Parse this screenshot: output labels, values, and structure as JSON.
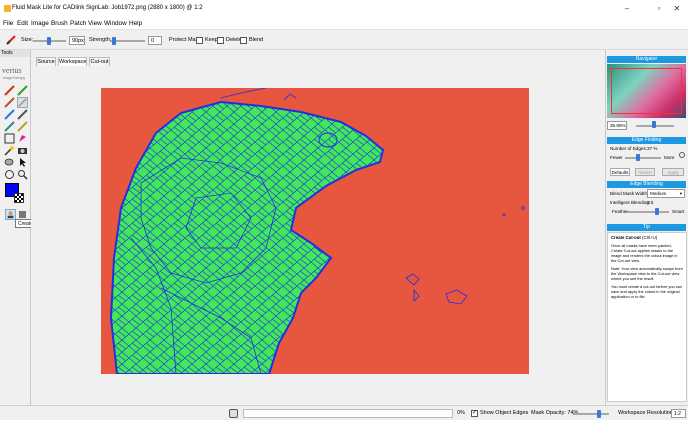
{
  "window": {
    "title": "Fluid Mask Lite for CADlink SignLab: Job1972.png (2880 x 1800) @ 1:2",
    "controls": [
      "minimize",
      "maximize",
      "close"
    ]
  },
  "menu": [
    "File",
    "Edit",
    "Image",
    "Brush",
    "Patch",
    "View",
    "Window",
    "Help"
  ],
  "toolbar": {
    "size_label": "Size:",
    "size_value": "90px",
    "strength_label": "Strength:",
    "strength_value": "0",
    "protect_label": "Protect Mask:",
    "keep_label": "Keep",
    "delete_label": "Delete",
    "blend_label": "Blend"
  },
  "left_panel": {
    "title": "Tools",
    "logo_text": "vertus",
    "logo_subtext": "image therapy",
    "tooltip": "Create Cut-out (Ctrl+U)"
  },
  "tabs": [
    "Source",
    "Workspace",
    "Cut-out"
  ],
  "active_tab": "Workspace",
  "navigator": {
    "title": "Navigator",
    "zoom": "35.86%"
  },
  "edge_finding": {
    "title": "Edge Finding",
    "edges_label": "Number of Edges:",
    "edges_value": "37 %",
    "fewer": "Fewer",
    "more": "More",
    "buttons": [
      "Defaults",
      "Revert",
      "Apply"
    ]
  },
  "edge_blending": {
    "title": "Edge Blending",
    "blend_width_label": "Blend Mask Width:",
    "blend_width_value": "Medium",
    "intelligent_label": "Intelligent Blending:",
    "intelligent_value": "0.5",
    "feather_label": "Feather",
    "smart_label": "Smart"
  },
  "tip": {
    "title": "Tip",
    "heading": "Create Cut-out",
    "shortcut": "(Ctrl+U)",
    "p1": "Once all masks have been painted, Create Cut-out applies masks to the image and renders the cutout image in the Cut-out view.",
    "p2": "Note: Your view automatically swaps from the Workspace view to the Cut-out view where you see the result.",
    "p3": "You must create a cut-out before you can save and apply the cutout in the original application or to file."
  },
  "status": {
    "progress": "0%",
    "show_edges_label": "Show Object Edges",
    "show_edges_checked": true,
    "mask_opacity": "Mask Opacity: 74%",
    "mask_opacity_level": 0.74,
    "workspace_resolution_label": "Workspace Resolution:",
    "workspace_resolution_value": "1:2"
  },
  "colors": {
    "image_bg": "#e7563f",
    "mask_green": "#43e85a",
    "edges_blue": "#2030e0",
    "panel_header": "#1d99e3",
    "foreground_swatch": "#0000ff"
  }
}
